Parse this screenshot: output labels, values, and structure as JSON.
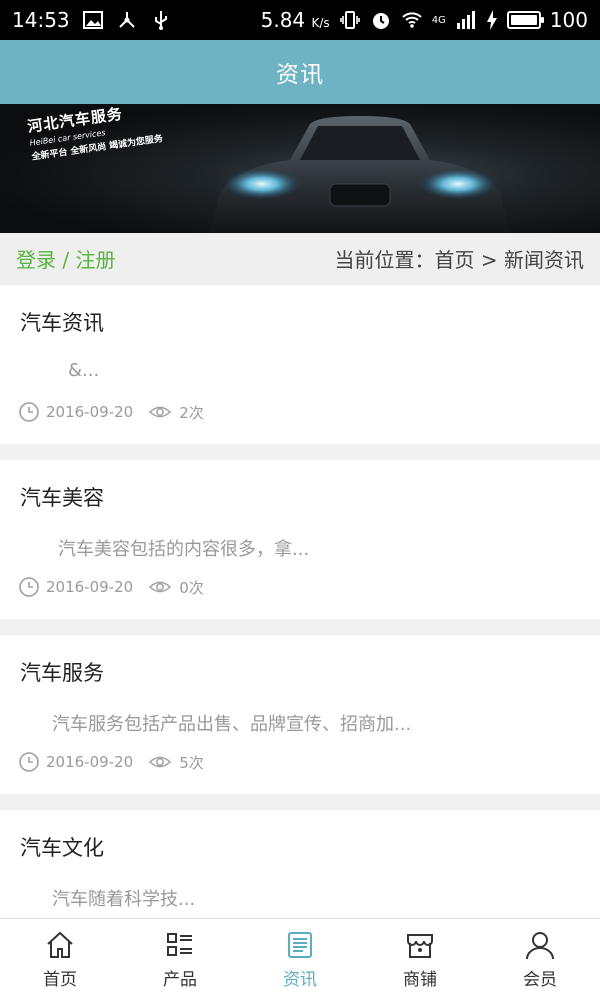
{
  "status_bar": {
    "time": "14:53",
    "speed": "5.84",
    "speed_unit": "K/s",
    "network": "4G",
    "battery": "100"
  },
  "header": {
    "title": "资讯"
  },
  "banner": {
    "brand_cn": "河北汽车服务",
    "brand_en": "HeiBei car services",
    "slogan": "全新平台 全新风尚 竭诚为您服务"
  },
  "location_bar": {
    "login_register": "登录 / 注册",
    "current_location": "当前位置：首页 > 新闻资讯"
  },
  "articles": [
    {
      "title": "汽车资讯",
      "summary": "&...",
      "date": "2016-09-20",
      "views": "2次"
    },
    {
      "title": "汽车美容",
      "summary": "汽车美容包括的内容很多，拿...",
      "date": "2016-09-20",
      "views": "0次"
    },
    {
      "title": "汽车服务",
      "summary": "汽车服务包括产品出售、品牌宣传、招商加...",
      "date": "2016-09-20",
      "views": "5次"
    },
    {
      "title": "汽车文化",
      "summary": "汽车随着科学技...",
      "date": "",
      "views": ""
    }
  ],
  "bottom_nav": {
    "items": [
      {
        "label": "首页",
        "icon": "home-icon"
      },
      {
        "label": "产品",
        "icon": "list-icon"
      },
      {
        "label": "资讯",
        "icon": "news-icon"
      },
      {
        "label": "商铺",
        "icon": "shop-icon"
      },
      {
        "label": "会员",
        "icon": "user-icon"
      }
    ],
    "active_index": 2
  },
  "colors": {
    "header_bg": "#6db3c4",
    "login_green": "#58b53c",
    "nav_active": "#5aaec0"
  }
}
